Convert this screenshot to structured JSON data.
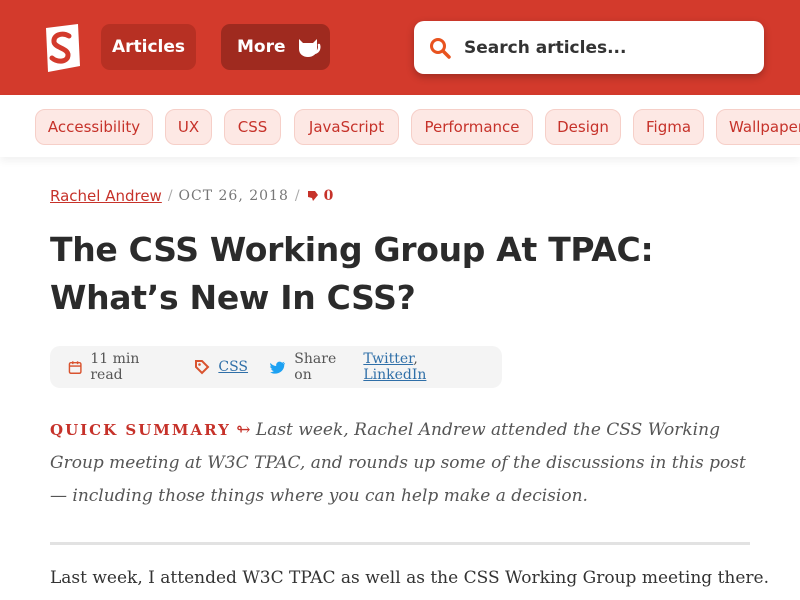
{
  "header": {
    "logo_icon": "smashing-magazine-logo-icon",
    "nav": [
      {
        "label": "Articles"
      },
      {
        "label": "More",
        "icon": "cat-icon"
      }
    ],
    "search": {
      "placeholder": "Search articles...",
      "icon": "search-icon"
    },
    "colors": {
      "brand": "#d33a2c",
      "accent": "#c6322a"
    }
  },
  "tags": [
    "Accessibility",
    "UX",
    "CSS",
    "JavaScript",
    "Performance",
    "Design",
    "Figma",
    "Wallpapers"
  ],
  "article": {
    "author": "Rachel Andrew",
    "separator": "/",
    "date": "OCT 26, 2018",
    "comments_icon": "comment-icon",
    "comments_count": "0",
    "title": "The CSS Working Group At TPAC: What’s New In CSS?",
    "info": {
      "read_time": "11 min read",
      "read_time_icon": "calendar-icon",
      "tag_icon": "tag-icon",
      "tag": "CSS",
      "share_icon": "twitter-icon",
      "share_prefix": "Share on",
      "share_twitter": "Twitter",
      "share_comma": ",",
      "share_linkedin": "LinkedIn"
    },
    "summary_label": "QUICK SUMMARY",
    "summary_arrow": "↬",
    "summary_text": "Last week, Rachel Andrew attended the CSS Working Group meeting at W3C TPAC, and rounds up some of the discussions in this post — including those things where you can help make a decision.",
    "first_paragraph": "Last week, I attended W3C TPAC as well as the CSS Working Group meeting there."
  }
}
